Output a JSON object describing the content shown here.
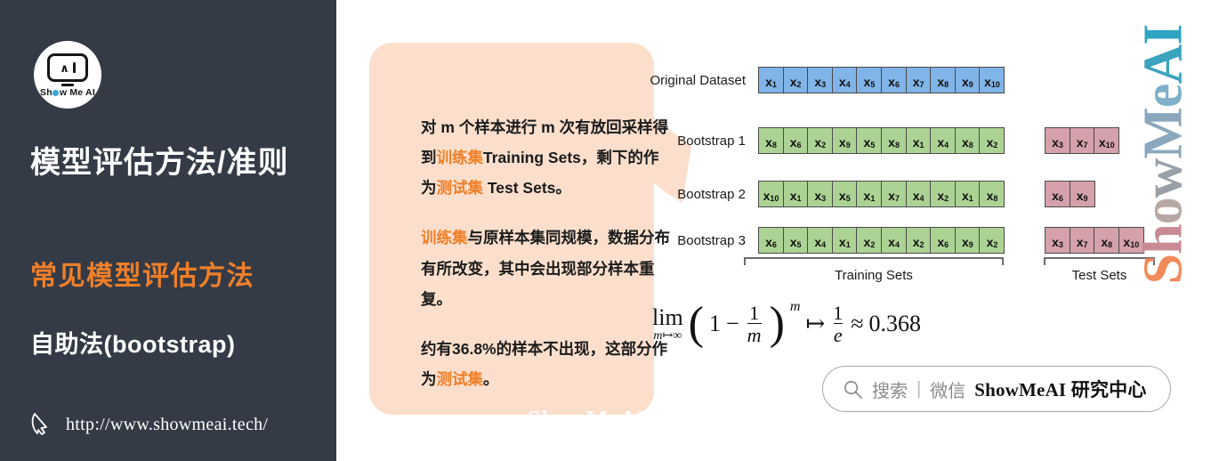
{
  "left_panel": {
    "logo": {
      "caret": "∧",
      "wordmark_pre": "Sh",
      "wordmark_post": "w Me AI"
    },
    "title": "模型评估方法/准则",
    "subtitle_highlight": "常见模型评估方法",
    "subtitle_method": "自助法(bootstrap)",
    "url": "http://www.showmeai.tech/",
    "accent_color": "#f07f28",
    "background_color": "#343b47"
  },
  "bubble": {
    "background_color": "#fbdfcc",
    "paragraph1": {
      "part1": "对 m 个样本进行 m 次有放回采样得到",
      "hl1": "训练集",
      "part2": "Training Sets，剩下的作为",
      "hl2": "测试集",
      "part3": " Test Sets。"
    },
    "paragraph2": {
      "hl1": "训练集",
      "part1": "与原样本集同规模，数据分布有所改变，其中会出现部分样本重复。"
    },
    "paragraph3": {
      "part1": "约有",
      "value": "36.8%",
      "part2": "的样本不出现，这部分作为",
      "hl1": "测试集",
      "part3": "。"
    },
    "watermark": "ShowMeAI"
  },
  "diagram": {
    "rows": [
      {
        "label": "Original Dataset",
        "color": "blue",
        "cells": [
          "1",
          "2",
          "3",
          "4",
          "5",
          "6",
          "7",
          "8",
          "9",
          "10"
        ]
      },
      {
        "label": "Bootstrap 1",
        "color": "green",
        "cells": [
          "8",
          "6",
          "2",
          "9",
          "5",
          "8",
          "1",
          "4",
          "8",
          "2"
        ]
      },
      {
        "label": "Bootstrap 2",
        "color": "green",
        "cells": [
          "10",
          "1",
          "3",
          "5",
          "1",
          "7",
          "4",
          "2",
          "1",
          "8"
        ]
      },
      {
        "label": "Bootstrap 3",
        "color": "green",
        "cells": [
          "6",
          "5",
          "4",
          "1",
          "2",
          "4",
          "2",
          "6",
          "9",
          "2"
        ]
      }
    ],
    "test_rows": [
      {
        "color": "pink",
        "cells": [
          "3",
          "7",
          "10"
        ]
      },
      {
        "color": "pink",
        "cells": [
          "6",
          "9"
        ]
      },
      {
        "color": "pink",
        "cells": [
          "3",
          "7",
          "8",
          "10"
        ]
      }
    ],
    "brace_training_label": "Training Sets",
    "brace_test_label": "Test Sets",
    "variable_symbol": "x",
    "colors": {
      "blue": "#81b4e8",
      "green": "#acd394",
      "pink": "#d5a1ab"
    }
  },
  "formula": {
    "lim_top": "lim",
    "lim_bottom": "m↦∞",
    "open_paren": "(",
    "one": "1",
    "minus": "−",
    "frac1_num": "1",
    "frac1_den": "m",
    "close_paren": ")",
    "exponent": "m",
    "maps_to": "↦",
    "frac2_num": "1",
    "frac2_den": "e",
    "approx": "≈",
    "result": "0.368"
  },
  "search_pill": {
    "icon": "search-icon",
    "grey_text": "搜索",
    "divider": "|",
    "grey_text2": "微信",
    "brand_text": "ShowMeAI 研究中心"
  },
  "vertical_watermark": {
    "letters": [
      "S",
      "h",
      "o",
      "w",
      "M",
      "e",
      "A",
      "I"
    ]
  }
}
